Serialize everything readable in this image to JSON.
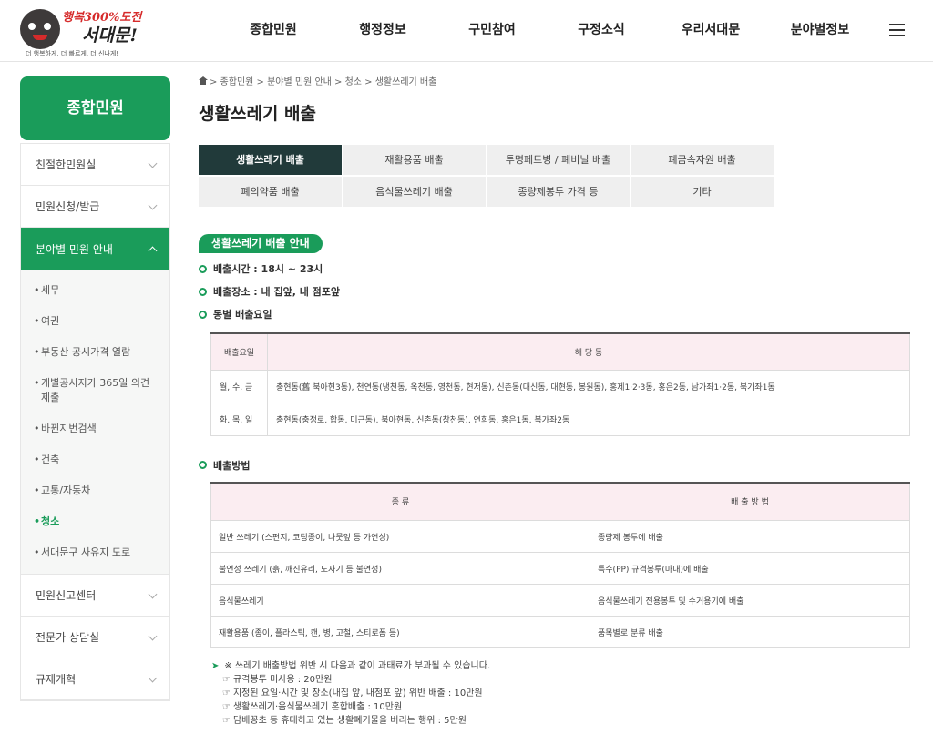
{
  "logo": {
    "slogan_line1": "행복300%",
    "slogan_line1b": "도전",
    "slogan_line2": "서대문!",
    "slogan_line3": "더 행복하게, 더 빠르게, 더 신나게!"
  },
  "gnb": [
    "종합민원",
    "행정정보",
    "구민참여",
    "구정소식",
    "우리서대문",
    "분야별정보"
  ],
  "sidebar": {
    "title": "종합민원",
    "items_top": [
      "친절한민원실",
      "민원신청/발급"
    ],
    "active": "분야별 민원 안내",
    "sub_items": [
      "세무",
      "여권",
      "부동산 공시가격 열람",
      "개별공시지가 365일 의견제출",
      "바뀐지번검색",
      "건축",
      "교통/자동차",
      "청소",
      "서대문구 사유지 도로"
    ],
    "sub_active_index": 7,
    "sub_bullet": "•",
    "items_bottom": [
      "민원신고센터",
      "전문가 상담실",
      "규제개혁"
    ]
  },
  "breadcrumb": "> 종합민원 > 분야별 민원 안내 > 청소 > 생활쓰레기 배출",
  "page_title": "생활쓰레기 배출",
  "tabs": [
    "생활쓰레기 배출",
    "재활용품 배출",
    "투명페트병 / 폐비닐 배출",
    "폐금속자원 배출",
    "폐의약품 배출",
    "음식물쓰레기 배출",
    "종량제봉투 가격 등",
    "기타"
  ],
  "section1": {
    "badge": "생활쓰레기 배출 안내",
    "time": "배출시간 : 18시 ~ 23시",
    "place": "배출장소 : 내 집앞, 내 점포앞",
    "days_label": "동별 배출요일",
    "table": {
      "headers": [
        "배출요일",
        "해 당 동"
      ],
      "rows": [
        [
          "월, 수, 금",
          "충현동(舊 북아현3동), 천연동(냉천동, 옥천동, 영천동, 현저동), 신촌동(대신동, 대현동, 봉원동), 홍제1·2·3동, 홍은2동, 남가좌1·2동, 북가좌1동"
        ],
        [
          "화, 목, 일",
          "충현동(충정로, 합동, 미근동), 북아현동, 신촌동(창천동), 연희동, 홍은1동, 북가좌2동"
        ]
      ]
    }
  },
  "section2": {
    "label": "배출방법",
    "table": {
      "headers": [
        "종 류",
        "배 출 방 법"
      ],
      "rows": [
        [
          "일반 쓰레기 (스펀지, 코팅종이, 나뭇잎 등 가연성)",
          "종량제 봉투에 배출"
        ],
        [
          "불연성 쓰레기 (흙, 깨진유리, 도자기 등 불연성)",
          "특수(PP) 규격봉투(마대)에 배출"
        ],
        [
          "음식물쓰레기",
          "음식물쓰레기 전용봉투 및 수거용기에 배출"
        ],
        [
          "재활용품 (종이, 플라스틱, 캔, 병, 고철, 스티로폼 등)",
          "품목별로 분류 배출"
        ]
      ]
    }
  },
  "notes": {
    "arrow": "➤",
    "head": "※ 쓰레기 배출방법 위반 시 다음과 같이 과태료가 부과될 수 있습니다.",
    "bullet": "☞",
    "items": [
      "규격봉투 미사용 : 20만원",
      "지정된 요일·시간 및 장소(내집 앞, 내점포 앞) 위반 배출 : 10만원",
      "생활쓰레기·음식물쓰레기 혼합배출 : 10만원",
      "담배꽁초 등 휴대하고 있는 생활폐기물을 버리는 행위 : 5만원"
    ]
  }
}
